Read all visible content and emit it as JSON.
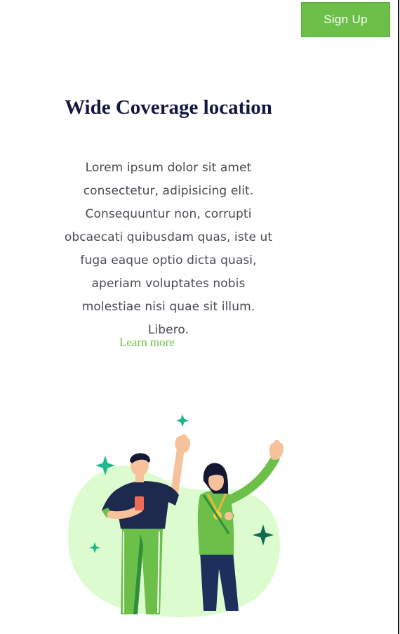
{
  "header": {
    "signup_label": "Sign Up"
  },
  "section": {
    "title": "Wide Coverage location",
    "body": "Lorem ipsum dolor sit amet consectetur, adipisicing elit. Consequuntur non, corrupti obcaecati quibusdam quas, iste ut fuga eaque optio dicta quasi, aperiam voluptates nobis molestiae nisi quae sit illum. Libero.",
    "link_label": "Learn more"
  },
  "illustration": {
    "icon": "people-waving-illustration"
  },
  "colors": {
    "accent": "#6cc04a",
    "heading": "#14183e",
    "body_text": "#4a4a52",
    "blob": "#dcfcd0",
    "sparkle": "#1db98a"
  }
}
